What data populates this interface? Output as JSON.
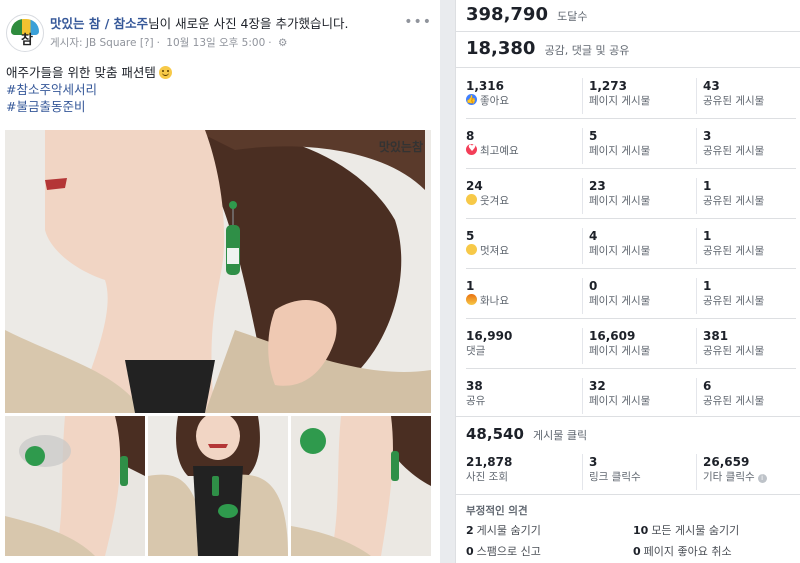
{
  "post": {
    "page_name": "맛있는 참 / 참소주",
    "title_rest": "님이 새로운 사진 4장을 추가했습니다.",
    "logo_text": "참",
    "poster_prefix": "게시자:",
    "poster": "JB Square",
    "poster_tag": "[?]",
    "date": "10월 13일 오후 5:00",
    "audience_icon": "gear-icon",
    "more": "•••",
    "text": "애주가들을 위한 맞춤 패션템",
    "hashtags": [
      "#참소주악세서리",
      "#불금출동준비"
    ],
    "photo_watermark": "맛있는참"
  },
  "insights": {
    "reach": {
      "value": "398,790",
      "label": "도달수"
    },
    "engagement": {
      "value": "18,380",
      "label": "공감, 댓글 및 공유"
    },
    "rows": [
      {
        "icon": "like-icon",
        "total": "1,316",
        "type": "좋아요",
        "page": "1,273",
        "page_label": "페이지 게시물",
        "shared": "43",
        "shared_label": "공유된 게시물"
      },
      {
        "icon": "love-icon",
        "total": "8",
        "type": "최고예요",
        "page": "5",
        "page_label": "페이지 게시물",
        "shared": "3",
        "shared_label": "공유된 게시물"
      },
      {
        "icon": "haha-icon",
        "total": "24",
        "type": "웃겨요",
        "page": "23",
        "page_label": "페이지 게시물",
        "shared": "1",
        "shared_label": "공유된 게시물"
      },
      {
        "icon": "wow-icon",
        "total": "5",
        "type": "멋져요",
        "page": "4",
        "page_label": "페이지 게시물",
        "shared": "1",
        "shared_label": "공유된 게시물"
      },
      {
        "icon": "angry-icon",
        "total": "1",
        "type": "화나요",
        "page": "0",
        "page_label": "페이지 게시물",
        "shared": "1",
        "shared_label": "공유된 게시물"
      },
      {
        "icon": "",
        "total": "16,990",
        "type": "댓글",
        "page": "16,609",
        "page_label": "페이지 게시물",
        "shared": "381",
        "shared_label": "공유된 게시물"
      },
      {
        "icon": "",
        "total": "38",
        "type": "공유",
        "page": "32",
        "page_label": "페이지 게시물",
        "shared": "6",
        "shared_label": "공유된 게시물"
      }
    ],
    "clicks": {
      "value": "48,540",
      "label": "게시물 클릭"
    },
    "click_stats": {
      "photo": {
        "value": "21,878",
        "label": "사진 조회"
      },
      "link": {
        "value": "3",
        "label": "링크 클릭수"
      },
      "other": {
        "value": "26,659",
        "label": "기타 클릭수",
        "info": "i"
      }
    },
    "negative": {
      "title": "부정적인 의견",
      "hide_post": {
        "value": "2",
        "label": "게시물 숨기기"
      },
      "hide_all": {
        "value": "10",
        "label": "모든 게시물 숨기기"
      },
      "spam": {
        "value": "0",
        "label": "스팸으로 신고"
      },
      "unlike": {
        "value": "0",
        "label": "페이지 좋아요 취소"
      }
    }
  }
}
